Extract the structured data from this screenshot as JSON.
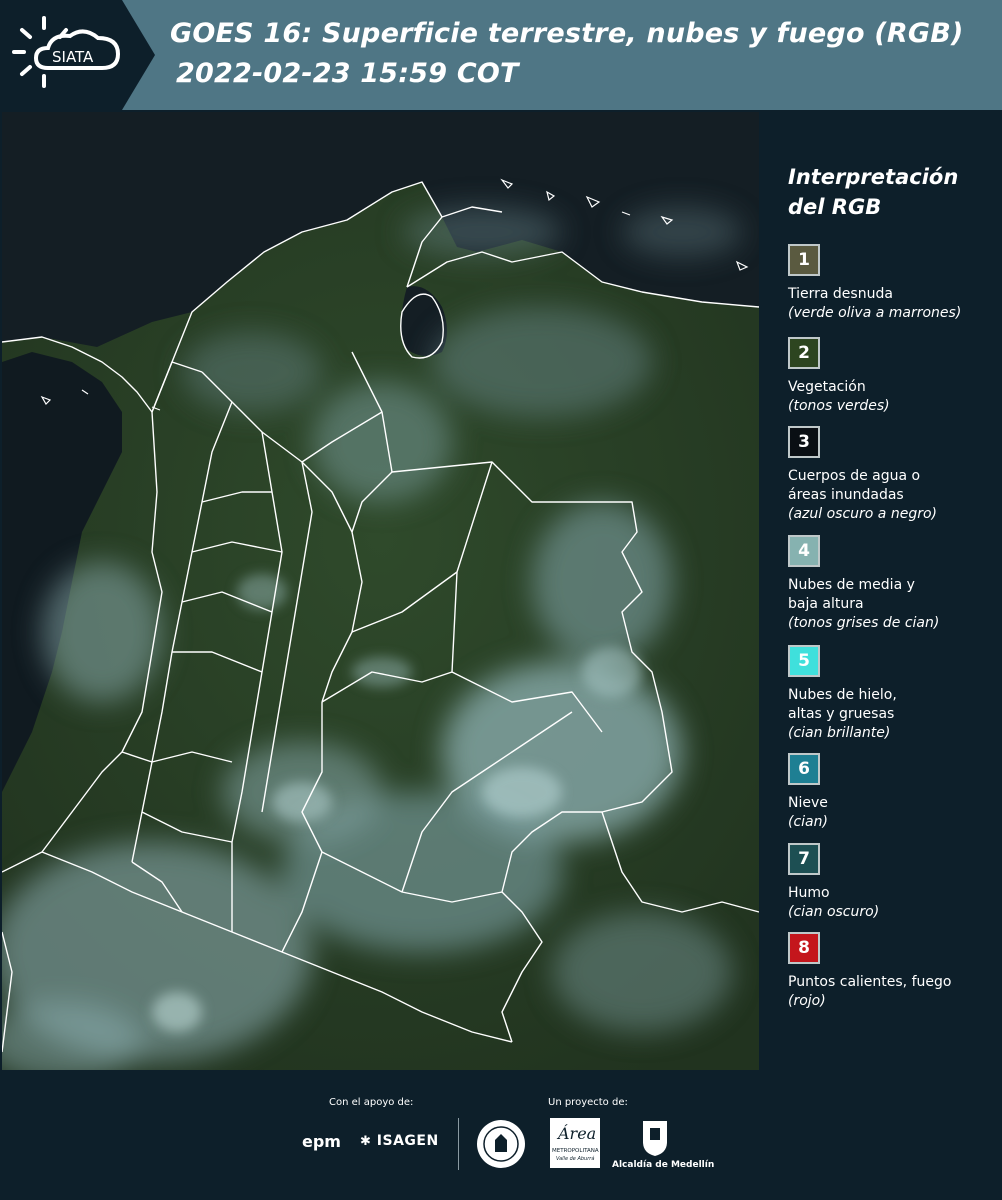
{
  "header": {
    "logo_text": "SIATA",
    "title_line1": "GOES 16: Superficie terrestre, nubes y fuego (RGB)",
    "title_line2": "2022-02-23 15:59 COT",
    "background_color": "#4f7685",
    "logo_panel_color": "#0d1f2a"
  },
  "legend": {
    "title": "Interpretación del RGB",
    "items": [
      {
        "number": "1",
        "label": "Tierra desnuda",
        "description": "(verde oliva a marrones)",
        "color": "#5a5a40"
      },
      {
        "number": "2",
        "label": "Vegetación",
        "description": "(tonos verdes)",
        "color": "#2d4520"
      },
      {
        "number": "3",
        "label": "Cuerpos de agua o áreas inundadas",
        "description": "(azul oscuro a negro)",
        "color": "#0a0f14"
      },
      {
        "number": "4",
        "label": "Nubes de media y baja altura",
        "description": "(tonos grises de cian)",
        "color": "#86b2b0"
      },
      {
        "number": "5",
        "label": "Nubes de hielo, altas y gruesas",
        "description": "(cian brillante)",
        "color": "#3fe0dc"
      },
      {
        "number": "6",
        "label": "Nieve",
        "description": "(cian)",
        "color": "#1e7f93"
      },
      {
        "number": "7",
        "label": "Humo",
        "description": "(cian oscuro)",
        "color": "#1d4f53"
      },
      {
        "number": "8",
        "label": "Puntos calientes, fuego",
        "description": "(rojo)",
        "color": "#c4161c"
      }
    ]
  },
  "footer": {
    "support_label": "Con el apoyo de:",
    "project_label": "Un proyecto de:",
    "sponsor1": "epm",
    "sponsor2": "ISAGEN",
    "partner_metropolitana": "METROPOLITANA",
    "partner_area": "Área",
    "partner_valle": "Valle de Aburrá",
    "partner_alcaldia": "Alcaldía de Medellín"
  },
  "map": {
    "description_colors": {
      "ocean": "#16232a",
      "land": "#2a4126",
      "cloud": "#8fb2b4",
      "border": "#ffffff"
    }
  }
}
